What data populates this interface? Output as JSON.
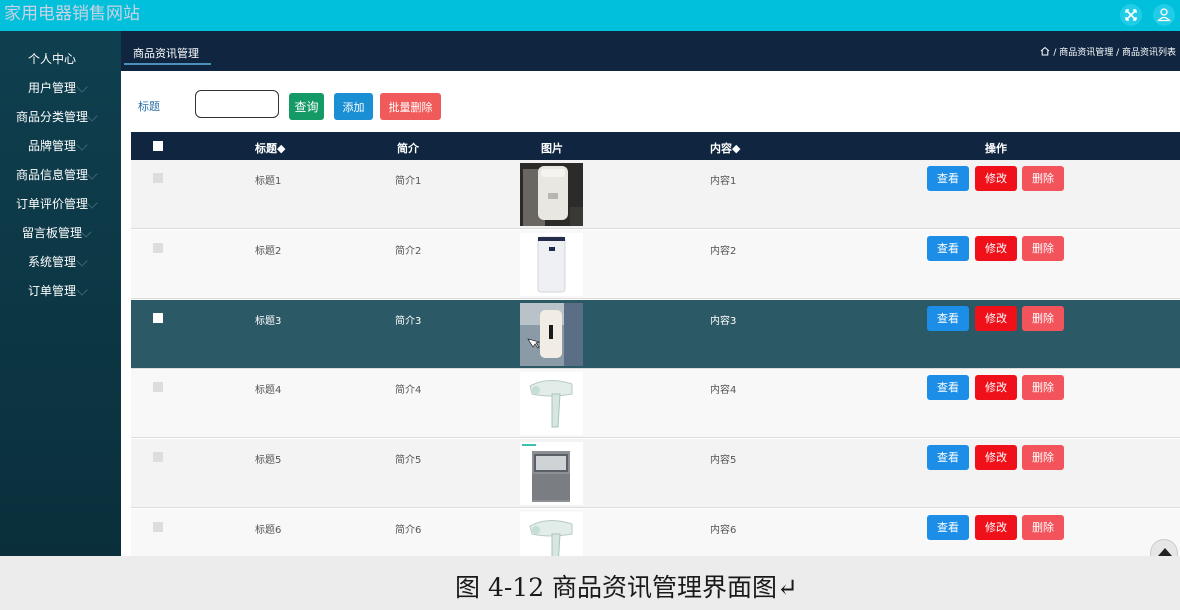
{
  "app": {
    "title": "家用电器销售网站"
  },
  "topbar": {
    "fullscreen_icon": "expand-icon",
    "user_icon": "user-icon"
  },
  "sidebar": {
    "items": [
      {
        "label": "个人中心",
        "has_caret": false
      },
      {
        "label": "用户管理",
        "has_caret": true
      },
      {
        "label": "商品分类管理",
        "has_caret": true
      },
      {
        "label": "品牌管理",
        "has_caret": true
      },
      {
        "label": "商品信息管理",
        "has_caret": true
      },
      {
        "label": "订单评价管理",
        "has_caret": true
      },
      {
        "label": "留言板管理",
        "has_caret": true
      },
      {
        "label": "系统管理",
        "has_caret": true
      },
      {
        "label": "订单管理",
        "has_caret": true
      }
    ]
  },
  "breadcrumb_bar": {
    "tab": "商品资讯管理",
    "crumbs": "/ 商品资讯管理 / 商品资讯列表",
    "home_icon": "home-icon"
  },
  "toolbar": {
    "search_label": "标题",
    "search_value": "",
    "query_label": "查询",
    "add_label": "添加",
    "batch_delete_label": "批量删除"
  },
  "table": {
    "columns": [
      "标题◆",
      "简介",
      "图片",
      "内容◆",
      "操作"
    ],
    "rows": [
      {
        "title": "标题1",
        "intro": "简介1",
        "image": "rice-cooker",
        "content": "内容1",
        "highlighted": false
      },
      {
        "title": "标题2",
        "intro": "简介2",
        "image": "air-purifier",
        "content": "内容2",
        "highlighted": false
      },
      {
        "title": "标题3",
        "intro": "简介3",
        "image": "water-heater",
        "content": "内容3",
        "highlighted": true
      },
      {
        "title": "标题4",
        "intro": "简介4",
        "image": "hair-dryer",
        "content": "内容4",
        "highlighted": false
      },
      {
        "title": "标题5",
        "intro": "简介5",
        "image": "dishwasher",
        "content": "内容5",
        "highlighted": false
      },
      {
        "title": "标题6",
        "intro": "简介6",
        "image": "hair-dryer",
        "content": "内容6",
        "highlighted": false
      }
    ],
    "actions": {
      "view": "查看",
      "edit": "修改",
      "delete": "删除"
    }
  },
  "scroll_top_icon": "arrow-up-icon",
  "caption": "图 4-12 商品资讯管理界面图↵",
  "colors": {
    "topbar": "#00c0dc",
    "sidebar": "#0f3f4f",
    "header": "#0f2540",
    "view_button": "#1c8ee8",
    "edit_button": "#f0101a",
    "delete_button": "#f3535b",
    "query_button": "#159a66",
    "add_button": "#1b8fd4",
    "batch_delete_button": "#f05a5a",
    "highlight_row": "#2b5965"
  }
}
